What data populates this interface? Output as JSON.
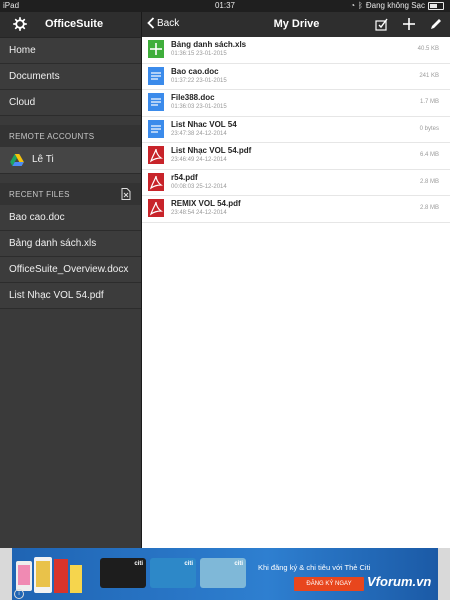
{
  "status_bar": {
    "device": "iPad",
    "time": "01:37",
    "charging_text": "Đang không Sạc"
  },
  "sidebar": {
    "app_title": "OfficeSuite",
    "nav_items": [
      {
        "label": "Home",
        "icon": "none"
      },
      {
        "label": "Documents",
        "icon": "none"
      },
      {
        "label": "Cloud",
        "icon": "none"
      }
    ],
    "remote_accounts_header": "REMOTE ACCOUNTS",
    "account": {
      "label": "Lê Ti",
      "icon": "google-drive-icon"
    },
    "recent_files_header": "RECENT FILES",
    "recent_files": [
      {
        "label": "Bao cao.doc"
      },
      {
        "label": "Bảng danh sách.xls"
      },
      {
        "label": "OfficeSuite_Overview.docx"
      },
      {
        "label": "List Nhạc VOL 54.pdf"
      }
    ]
  },
  "main": {
    "back_label": "Back",
    "title": "My Drive",
    "files": [
      {
        "name": "Bảng danh sách.xls",
        "meta": "01:36:15 23-01-2015",
        "size": "40.5 KB",
        "type": "sheet"
      },
      {
        "name": "Bao cao.doc",
        "meta": "01:37:22 23-01-2015",
        "size": "241 KB",
        "type": "doc"
      },
      {
        "name": "File388.doc",
        "meta": "01:36:03 23-01-2015",
        "size": "1.7 MB",
        "type": "doc"
      },
      {
        "name": "List Nhac VOL 54",
        "meta": "23:47:38 24-12-2014",
        "size": "0 bytes",
        "type": "doc"
      },
      {
        "name": "List Nhạc VOL 54.pdf",
        "meta": "23:46:49 24-12-2014",
        "size": "6.4 MB",
        "type": "pdf"
      },
      {
        "name": "r54.pdf",
        "meta": "00:08:03 25-12-2014",
        "size": "2.8 MB",
        "type": "pdf"
      },
      {
        "name": "REMIX VOL 54.pdf",
        "meta": "23:48:54 24-12-2014",
        "size": "2.8 MB",
        "type": "pdf"
      }
    ]
  },
  "ad": {
    "headline": "Khi đăng ký & chi tiêu với Thẻ Citi",
    "button_label": "ĐĂNG KÝ NGAY",
    "card_brand": "citi",
    "watermark": "Vforum.vn"
  },
  "colors": {
    "sidebar_bg": "#3a3a3a",
    "topbar_bg": "#2e2e2e",
    "doc_blue": "#3b8beb",
    "sheet_green": "#3fae3b",
    "pdf_red": "#c8242a",
    "ad_blue": "#2e7fd0",
    "ad_button": "#e8461d"
  }
}
